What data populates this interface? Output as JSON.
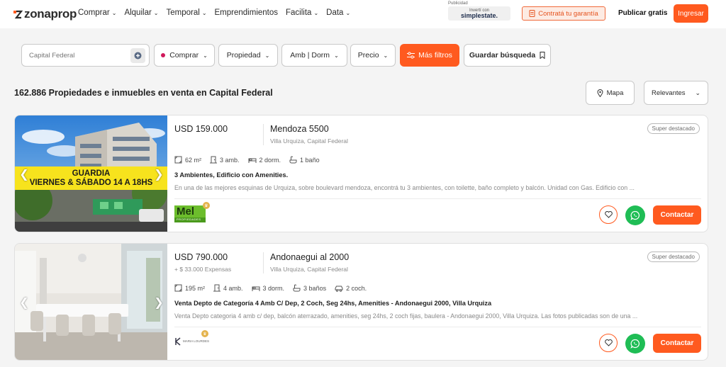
{
  "header": {
    "logo_text": "zonaprop",
    "nav": [
      {
        "label": "Comprar",
        "has_menu": true
      },
      {
        "label": "Alquilar",
        "has_menu": true
      },
      {
        "label": "Temporal",
        "has_menu": true
      },
      {
        "label": "Emprendimientos",
        "has_menu": false
      },
      {
        "label": "Facilita",
        "has_menu": true
      },
      {
        "label": "Data",
        "has_menu": true
      }
    ],
    "ad": {
      "label": "Publicidad",
      "small": "Invertí con",
      "brand": "simplestate."
    },
    "guarantee_label": "Contratá tu garantía",
    "publish_label": "Publicar gratis",
    "login_label": "Ingresar"
  },
  "filters": {
    "search_placeholder": "Capital Federal",
    "operation": "Comprar",
    "property": "Propiedad",
    "rooms": "Amb | Dorm",
    "price": "Precio",
    "more_filters": "Más filtros",
    "save_search": "Guardar búsqueda"
  },
  "results": {
    "title": "162.886 Propiedades e inmuebles en venta en Capital Federal",
    "map_label": "Mapa",
    "sort_label": "Relevantes"
  },
  "listings": [
    {
      "price": "USD 159.000",
      "expensas": "",
      "address": "Mendoza 5500",
      "location": "Villa Urquiza, Capital Federal",
      "tag": "Super destacado",
      "banner_line1": "GUARDIA",
      "banner_line2": "VIERNES & SÁBADO 14 A 18HS",
      "features": {
        "area": "62 m²",
        "amb": "3 amb.",
        "dorm": "2 dorm.",
        "bath": "1 baño"
      },
      "headline": "3 Ambientes, Edificio con Amenities.",
      "description": "En una de las mejores esquinas de Urquiza, sobre boulevard mendoza, encontrá tu 3 ambientes, con toilette, baño completo y balcón. Unidad con Gas. Edificio con ...",
      "agency_logo": "Mel",
      "agency_sub": "PROPIEDADES",
      "contact_label": "Contactar"
    },
    {
      "price": "USD 790.000",
      "expensas": "+ $ 33.000 Expensas",
      "address": "Andonaegui al 2000",
      "location": "Villa Urquiza, Capital Federal",
      "tag": "Super destacado",
      "features": {
        "area": "195 m²",
        "amb": "4 amb.",
        "dorm": "3 dorm.",
        "bath": "3 baños",
        "garage": "2 coch."
      },
      "headline": "Venta Depto de Categoría 4 Amb C/ Dep, 2 Coch, Seg 24hs, Amenities - Andonaegui 2000, Villa Urquiza",
      "description": "Venta Depto categoria 4 amb c/ dep, balcón aterrazado, amenities, seg 24hs, 2 coch fijas, baulera - Andonaegui 2000, Villa Urquiza. Las fotos publicadas son de una ...",
      "agency_logo": "MARIA LOURDES",
      "contact_label": "Contactar"
    }
  ],
  "colors": {
    "brand": "#ff5a1f",
    "whatsapp": "#1fbd55",
    "banner": "#f7e31d"
  }
}
